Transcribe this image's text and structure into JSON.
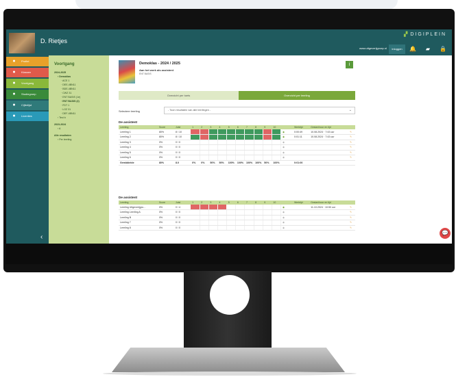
{
  "header": {
    "user_name": "D. Rietjes",
    "logo_text": "DIGIPLEIN",
    "url": "www.uitgeverijgroep.nl",
    "button": "Inloggen",
    "icons": [
      "bell-icon",
      "book-icon",
      "lock-icon"
    ]
  },
  "sidebar": {
    "items": [
      {
        "label": "Profiel",
        "icon": "person-icon",
        "color": "#e8a12a"
      },
      {
        "label": "Klassen",
        "icon": "users-icon",
        "color": "#e05a4a"
      },
      {
        "label": "Voortgang",
        "icon": "chart-icon",
        "color": "#8ab83a"
      },
      {
        "label": "Studiegroep",
        "icon": "group-icon",
        "color": "#3a8a3a"
      },
      {
        "label": "Cijferlijst",
        "icon": "list-icon",
        "color": "#2f7a7a"
      },
      {
        "label": "Licenties",
        "icon": "key-icon",
        "color": "#2a9ab8"
      }
    ],
    "collapse": "‹"
  },
  "tree": {
    "title": "Voortgang",
    "rows": [
      {
        "text": "2024-2025",
        "bold": true,
        "indent": 0
      },
      {
        "text": "› Demoklas",
        "bold": true,
        "indent": 1
      },
      {
        "text": "· ACE 1",
        "bold": false,
        "indent": 2
      },
      {
        "text": "· DEE-4BN11",
        "bold": false,
        "indent": 2
      },
      {
        "text": "· BDE-4BN11",
        "bold": false,
        "indent": 2
      },
      {
        "text": "· CWZ 31",
        "bold": false,
        "indent": 2
      },
      {
        "text": "· ENT BASIS (1e)",
        "bold": false,
        "indent": 2
      },
      {
        "text": "· ENT BASIS (2)",
        "bold": true,
        "indent": 2
      },
      {
        "text": "· FDT 1",
        "bold": false,
        "indent": 2
      },
      {
        "text": "· LOZ 31",
        "bold": false,
        "indent": 2
      },
      {
        "text": "· DEF-4BN11",
        "bold": false,
        "indent": 2
      },
      {
        "text": "› Test b",
        "bold": false,
        "indent": 1
      },
      {
        "text": "2023-2024",
        "bold": true,
        "indent": 0
      },
      {
        "text": "› A",
        "bold": false,
        "indent": 1
      },
      {
        "text": "Alle resultaten",
        "bold": true,
        "indent": 0
      },
      {
        "text": "› Per leerling",
        "bold": false,
        "indent": 1
      }
    ]
  },
  "content": {
    "title": "Demoklas - 2024 / 2025",
    "subtitle": "Aan het werk als assistent",
    "code": "ENT BASIS",
    "info_icon": "i",
    "tabs": [
      "Overzicht per toets",
      "Overzicht per leerling"
    ],
    "select_label": "Selecteer leerling",
    "select_value": "- Toon resultaten van alle leerlingen -"
  },
  "section1": {
    "title": "De assistent",
    "headers": [
      "Leerling",
      "Score",
      "Juist",
      "1",
      "2",
      "3",
      "4",
      "5",
      "6",
      "7",
      "8",
      "9",
      "10",
      "",
      "Werktijd",
      "Gestart/voor en tijd",
      ""
    ],
    "rows": [
      {
        "name": "Leerling 1",
        "score": "80%",
        "juist": "8 / 10",
        "cells": [
          "r",
          "r",
          "g",
          "g",
          "g",
          "g",
          "g",
          "g",
          "r",
          "g"
        ],
        "eye": true,
        "werktijd": "0:00:49",
        "datum": "10.08.2024 · 7:43 uur"
      },
      {
        "name": "Leerling 2",
        "score": "80%",
        "juist": "8 / 10",
        "cells": [
          "g",
          "r",
          "g",
          "g",
          "g",
          "g",
          "g",
          "g",
          "r",
          "g"
        ],
        "eye": true,
        "werktijd": "0:01:11",
        "datum": "10.08.2024 · 7:43 uur"
      },
      {
        "name": "Leerling 3",
        "score": "0%",
        "juist": "0 / 0",
        "cells": [
          "e",
          "e",
          "e",
          "e",
          "e",
          "e",
          "e",
          "e",
          "e",
          "e"
        ],
        "eye": false,
        "werktijd": "",
        "datum": ""
      },
      {
        "name": "Leerling 4",
        "score": "0%",
        "juist": "0 / 0",
        "cells": [
          "e",
          "e",
          "e",
          "e",
          "e",
          "e",
          "e",
          "e",
          "e",
          "e"
        ],
        "eye": false,
        "werktijd": "",
        "datum": ""
      },
      {
        "name": "Leerling 5",
        "score": "0%",
        "juist": "0 / 0",
        "cells": [
          "e",
          "e",
          "e",
          "e",
          "e",
          "e",
          "e",
          "e",
          "e",
          "e"
        ],
        "eye": false,
        "werktijd": "",
        "datum": ""
      },
      {
        "name": "Leerling 6",
        "score": "0%",
        "juist": "0 / 0",
        "cells": [
          "e",
          "e",
          "e",
          "e",
          "e",
          "e",
          "e",
          "e",
          "e",
          "e"
        ],
        "eye": false,
        "werktijd": "",
        "datum": ""
      }
    ],
    "avg": {
      "name": "Gemiddelde",
      "score": "80%",
      "juist": "8.0",
      "cells": [
        "0%",
        "0%",
        "50%",
        "50%",
        "100%",
        "100%",
        "100%",
        "100%",
        "50%",
        "100%"
      ],
      "werktijd": "0:01:00"
    }
  },
  "section2": {
    "title": "De assistent",
    "headers": [
      "Leerling",
      "Score",
      "Juist",
      "1",
      "2",
      "3",
      "4",
      "5",
      "6",
      "7",
      "8",
      "9",
      "10",
      "",
      "Werktijd",
      "Gestart/voor en tijd",
      ""
    ],
    "rows": [
      {
        "name": "Leerling Uitgeverijgro…",
        "score": "0%",
        "juist": "0 / 4",
        "cells": [
          "r",
          "r",
          "r",
          "r",
          "e",
          "e",
          "e",
          "e",
          "e",
          "e"
        ],
        "eye": true,
        "werktijd": "",
        "datum": "11.10.2024 · 10:50 uur"
      },
      {
        "name": "Leerling Leerling A",
        "score": "0%",
        "juist": "0 / 0",
        "cells": [
          "e",
          "e",
          "e",
          "e",
          "e",
          "e",
          "e",
          "e",
          "e",
          "e"
        ],
        "eye": false,
        "werktijd": "",
        "datum": ""
      },
      {
        "name": "Leerling B",
        "score": "0%",
        "juist": "0 / 0",
        "cells": [
          "e",
          "e",
          "e",
          "e",
          "e",
          "e",
          "e",
          "e",
          "e",
          "e"
        ],
        "eye": false,
        "werktijd": "",
        "datum": ""
      },
      {
        "name": "Leerling 7",
        "score": "0%",
        "juist": "0 / 0",
        "cells": [
          "e",
          "e",
          "e",
          "e",
          "e",
          "e",
          "e",
          "e",
          "e",
          "e"
        ],
        "eye": false,
        "werktijd": "",
        "datum": ""
      },
      {
        "name": "Leerling 8",
        "score": "0%",
        "juist": "0 / 0",
        "cells": [
          "e",
          "e",
          "e",
          "e",
          "e",
          "e",
          "e",
          "e",
          "e",
          "e"
        ],
        "eye": false,
        "werktijd": "",
        "datum": ""
      }
    ]
  },
  "colors": {
    "primary": "#1f5a5e",
    "tree": "#c8dc98",
    "wrong": "#e06565",
    "right": "#3f9a5e",
    "accent": "#5a9a3a",
    "chat": "#e04848"
  }
}
